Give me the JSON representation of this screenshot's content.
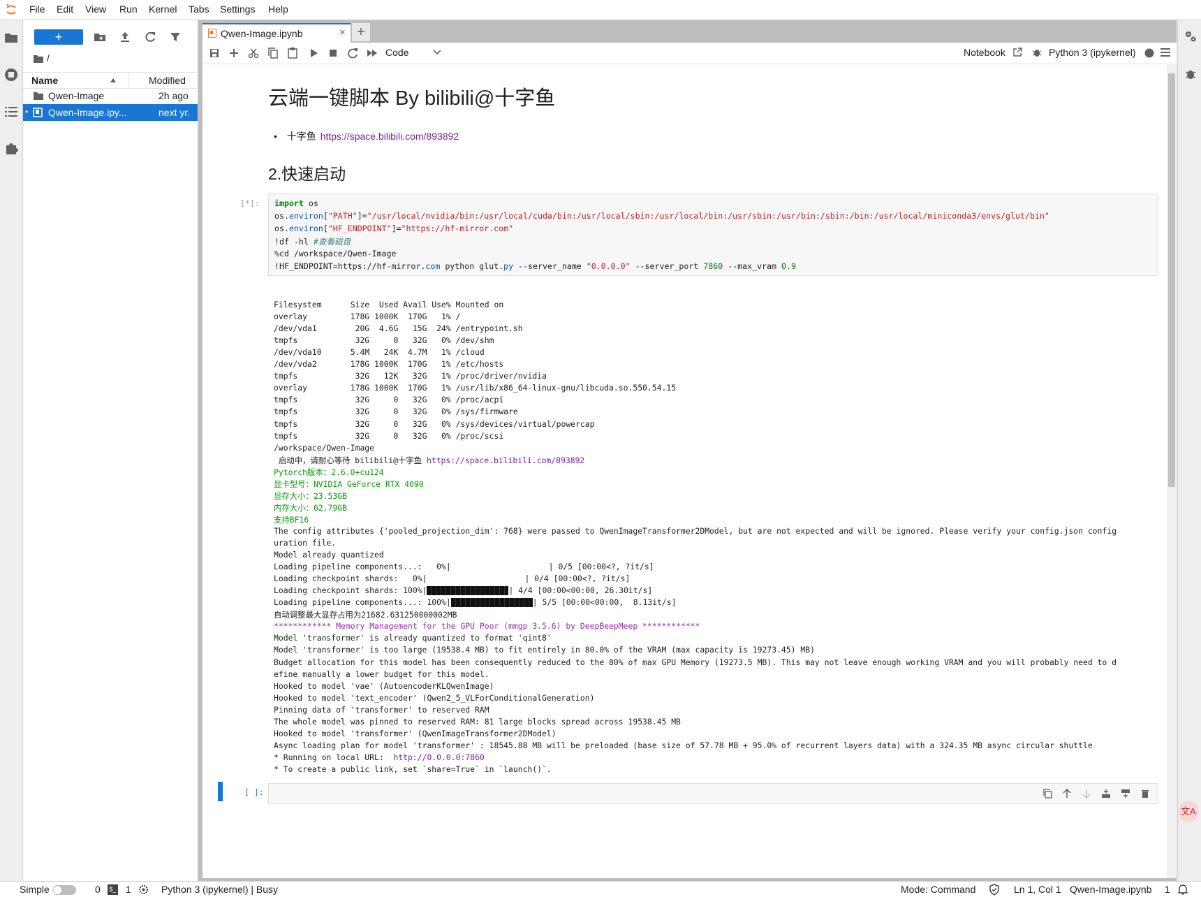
{
  "menu": [
    "File",
    "Edit",
    "View",
    "Run",
    "Kernel",
    "Tabs",
    "Settings",
    "Help"
  ],
  "file_browser": {
    "path": "/",
    "col_name": "Name",
    "col_modified": "Modified",
    "items": [
      {
        "name": "Qwen-Image",
        "modified": "2h ago",
        "type": "folder",
        "selected": false
      },
      {
        "name": "Qwen-Image.ipy...",
        "modified": "next yr.",
        "type": "notebook",
        "selected": true
      }
    ]
  },
  "tab": {
    "title": "Qwen-Image.ipynb"
  },
  "toolbar": {
    "cell_type": "Code",
    "notebook_label": "Notebook",
    "kernel": "Python 3 (ipykernel)"
  },
  "markdown": {
    "h1": "云端一键脚本 By bilibili@十字鱼",
    "bullet_prefix": "十字鱼",
    "bullet_link": "https://space.bilibili.com/893892",
    "h2": "2.快速启动"
  },
  "cell1": {
    "prompt": "[*]:",
    "code": {
      "l1_kw": "import",
      "l1_rest": " os",
      "l2_a": "os.",
      "l2_attr": "environ",
      "l2_b": "[",
      "l2_str1": "\"PATH\"",
      "l2_c": "]=",
      "l2_str2": "\"/usr/local/nvidia/bin:/usr/local/cuda/bin:/usr/local/sbin:/usr/local/bin:/usr/sbin:/usr/bin:/sbin:/bin:/usr/local/miniconda3/envs/glut/bin\"",
      "l3_a": "os.",
      "l3_attr": "environ",
      "l3_b": "[",
      "l3_str1": "\"HF_ENDPOINT\"",
      "l3_c": "]=",
      "l3_str2": "\"https://hf-mirror.com\"",
      "l4_a": "!df -hl ",
      "l4_cmt": "#查看磁盘",
      "l5": "%cd /workspace/Qwen-Image",
      "l6_a": "!HF_ENDPOINT=https://hf-mirror.",
      "l6_attr": "com",
      "l6_b": " python glut.",
      "l6_attr2": "py",
      "l6_c": " --server_name ",
      "l6_str": "\"0.0.0.0\"",
      "l6_d": " --server_port ",
      "l6_num1": "7860",
      "l6_e": " --max_vram ",
      "l6_num2": "0.9"
    },
    "output": {
      "df": [
        "Filesystem      Size  Used Avail Use% Mounted on",
        "overlay         178G 1000K  170G   1% /",
        "/dev/vda1        20G  4.6G   15G  24% /entrypoint.sh",
        "tmpfs            32G     0   32G   0% /dev/shm",
        "/dev/vda10      5.4M   24K  4.7M   1% /cloud",
        "/dev/vda2       178G 1000K  170G   1% /etc/hosts",
        "tmpfs            32G   12K   32G   1% /proc/driver/nvidia",
        "overlay         178G 1000K  170G   1% /usr/lib/x86_64-linux-gnu/libcuda.so.550.54.15",
        "tmpfs            32G     0   32G   0% /proc/acpi",
        "tmpfs            32G     0   32G   0% /sys/firmware",
        "tmpfs            32G     0   32G   0% /sys/devices/virtual/powercap",
        "tmpfs            32G     0   32G   0% /proc/scsi",
        "/workspace/Qwen-Image"
      ],
      "starting_text": " 启动中，请耐心等待 bilibili@十字鱼 ",
      "starting_link": "https://space.bilibili.com/893892",
      "green_lines": [
        "Pytorch版本：2.6.0+cu124",
        "显卡型号：NVIDIA GeForce RTX 4090",
        "显存大小：23.53GB",
        "内存大小：62.79GB",
        "支持BF16"
      ],
      "config_line1": "The config attributes {'pooled_projection_dim': 768} were passed to QwenImageTransformer2DModel, but are not expected and will be ignored. Please verify your config.json config",
      "config_line2": "uration file.",
      "model_quantized": "Model already quantized",
      "progress": [
        {
          "label": "Loading pipeline components...:   0%|",
          "fill": 0,
          "suffix": "| 0/5 [00:00<?, ?it/s]"
        },
        {
          "label": "Loading checkpoint shards:   0%|",
          "fill": 0,
          "suffix": "| 0/4 [00:00<?, ?it/s]"
        },
        {
          "label": "Loading checkpoint shards: 100%|",
          "fill": 1,
          "suffix": "| 4/4 [00:00<00:00, 26.30it/s]"
        },
        {
          "label": "Loading pipeline components...: 100%|",
          "fill": 1,
          "suffix": "| 5/5 [00:00<00:00,  8.13it/s]"
        }
      ],
      "auto_adjust": "自动调整最大显存占用为21682.631250000002MB",
      "mmgp_header": "************ Memory Management for the GPU Poor (mmgp 3.5.6) by DeepBeepMeep ************",
      "tail": [
        "Model 'transformer' is already quantized to format 'qint8'",
        "Model 'transformer' is too large (19538.4 MB) to fit entirely in 80.0% of the VRAM (max capacity is 19273.45) MB)",
        "Budget allocation for this model has been consequently reduced to the 80% of max GPU Memory (19273.5 MB). This may not leave enough working VRAM and you will probably need to d",
        "efine manually a lower budget for this model.",
        "Hooked to model 'vae' (AutoencoderKLQwenImage)",
        "Hooked to model 'text_encoder' (Qwen2_5_VLForConditionalGeneration)",
        "Pinning data of 'transformer' to reserved RAM",
        "The whole model was pinned to reserved RAM: 81 large blocks spread across 19538.45 MB",
        "Hooked to model 'transformer' (QwenImageTransformer2DModel)",
        "Async loading plan for model 'transformer' : 18545.88 MB will be preloaded (base size of 57.78 MB + 95.0% of recurrent layers data) with a 324.35 MB async circular shuttle"
      ],
      "running_prefix": "* Running on local URL:  ",
      "running_link": "http://0.0.0.0:7860",
      "share_line": "* To create a public link, set `share=True` in `launch()`."
    }
  },
  "cell2": {
    "prompt": "[ ]:"
  },
  "status": {
    "mode_label": "Simple",
    "count1": "0",
    "count2": "1",
    "kernel_status": "Python 3 (ipykernel) | Busy",
    "mode": "Mode: Command",
    "position": "Ln 1, Col 1",
    "file": "Qwen-Image.ipynb",
    "notifications": "1"
  },
  "colors": {
    "accent": "#1976d2",
    "selected_bg": "#1976d2",
    "green_output": "#00a000",
    "link": "#7b1fa2"
  }
}
